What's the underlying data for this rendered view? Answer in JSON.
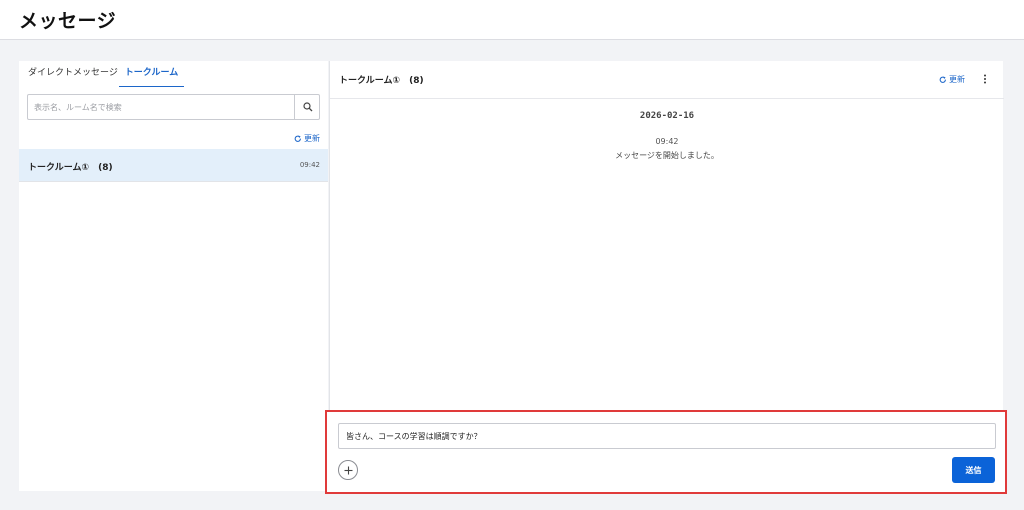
{
  "page": {
    "title": "メッセージ"
  },
  "left_panel": {
    "tabs": [
      {
        "label": "ダイレクトメッセージ",
        "active": false
      },
      {
        "label": "トークルーム",
        "active": true
      }
    ],
    "search": {
      "placeholder": "表示名、ルーム名で検索",
      "value": ""
    },
    "refresh_label": "更新",
    "rooms": [
      {
        "name": "トークルーム①　(8)",
        "time": "09:42",
        "selected": true
      }
    ]
  },
  "chat": {
    "title": "トークルーム①　(8)",
    "refresh_label": "更新",
    "date": "2026-02-16",
    "messages": [
      {
        "time": "09:42",
        "text": "メッセージを開始しました。"
      }
    ]
  },
  "composer": {
    "value": "皆さん、コースの学習は順調ですか？",
    "send_label": "送信"
  },
  "colors": {
    "accent": "#0b63d8",
    "selected_row": "#e3effa",
    "highlight_border": "#e03a3a"
  },
  "icons": [
    "search-icon",
    "refresh-icon",
    "more-vertical-icon",
    "plus-icon"
  ]
}
